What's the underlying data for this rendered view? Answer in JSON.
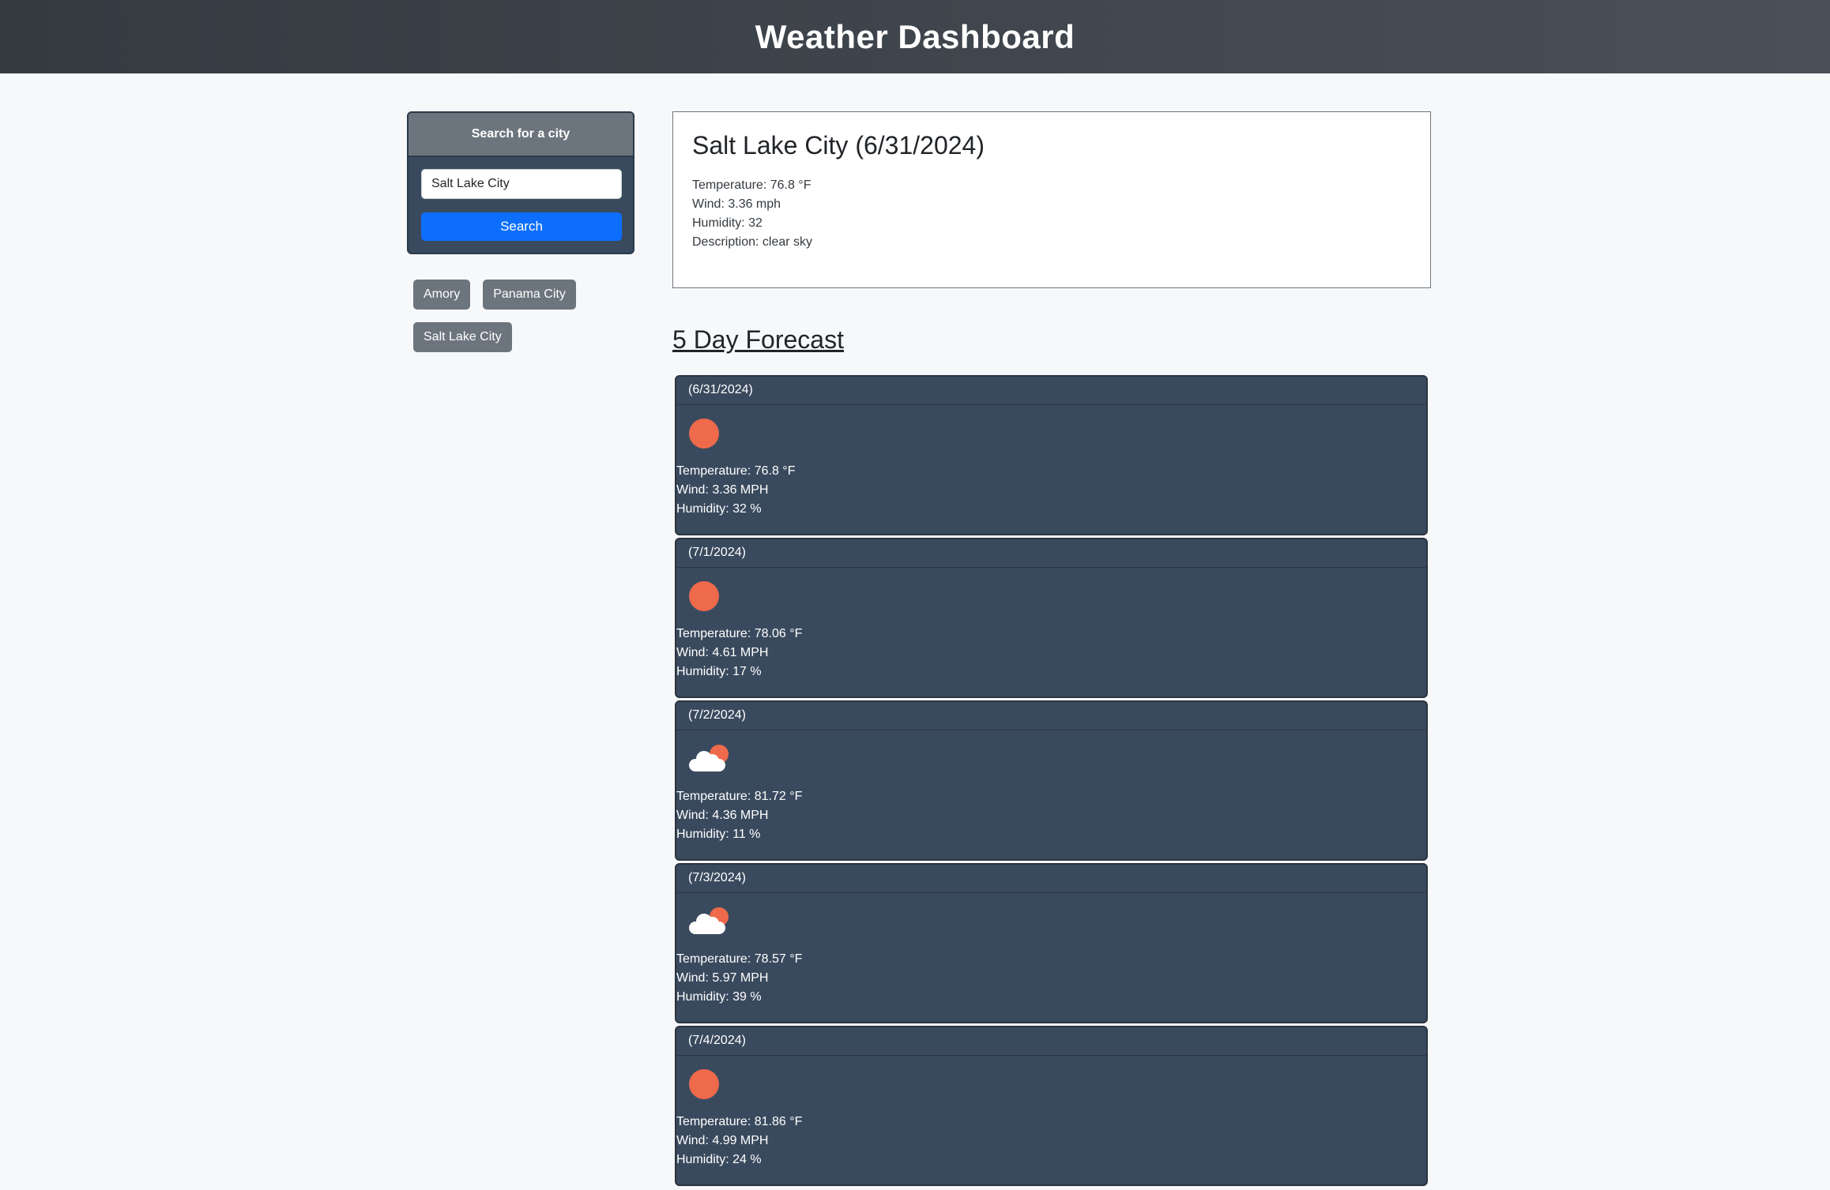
{
  "header": {
    "title": "Weather Dashboard"
  },
  "search": {
    "card_title": "Search for a city",
    "input_value": "Salt Lake City",
    "button_label": "Search"
  },
  "history": [
    "Amory",
    "Panama City",
    "Salt Lake City"
  ],
  "current": {
    "title": "Salt Lake City (6/31/2024)",
    "temperature": "Temperature: 76.8 °F",
    "wind": "Wind: 3.36 mph",
    "humidity": "Humidity: 32",
    "description": "Description: clear sky"
  },
  "forecast": {
    "title": "5 Day Forecast",
    "days": [
      {
        "date": "(6/31/2024)",
        "icon": "sun-icon",
        "temperature": "Temperature: 76.8 °F",
        "wind": "Wind: 3.36 MPH",
        "humidity": "Humidity: 32 %"
      },
      {
        "date": "(7/1/2024)",
        "icon": "sun-icon",
        "temperature": "Temperature: 78.06 °F",
        "wind": "Wind: 4.61 MPH",
        "humidity": "Humidity: 17 %"
      },
      {
        "date": "(7/2/2024)",
        "icon": "partly-cloudy-icon",
        "temperature": "Temperature: 81.72 °F",
        "wind": "Wind: 4.36 MPH",
        "humidity": "Humidity: 11 %"
      },
      {
        "date": "(7/3/2024)",
        "icon": "partly-cloudy-icon",
        "temperature": "Temperature: 78.57 °F",
        "wind": "Wind: 5.97 MPH",
        "humidity": "Humidity: 39 %"
      },
      {
        "date": "(7/4/2024)",
        "icon": "sun-icon",
        "temperature": "Temperature: 81.86 °F",
        "wind": "Wind: 4.99 MPH",
        "humidity": "Humidity: 24 %"
      }
    ]
  },
  "colors": {
    "header_dark": "#343a40",
    "card_bg": "#3a4a5e",
    "button_primary": "#0d6efd",
    "button_secondary": "#6c757d",
    "sun": "#ee6a4a"
  }
}
